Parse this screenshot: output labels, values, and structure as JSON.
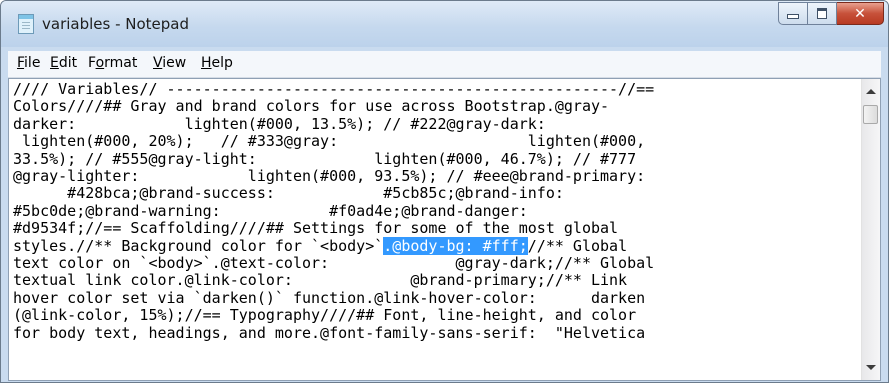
{
  "window": {
    "title": "variables - Notepad",
    "icon": "notepad-icon",
    "controls": {
      "minimize": "minimize-icon",
      "maximize": "maximize-icon",
      "close": "close-icon",
      "close_glyph": "✕"
    },
    "close_color": "#c7513a"
  },
  "menu": {
    "items": [
      {
        "first": "F",
        "rest": "ile"
      },
      {
        "first": "E",
        "rest": "dit"
      },
      {
        "first": "F",
        "rest": "ormat",
        "underline_index": 1
      },
      {
        "first": "V",
        "rest": "iew"
      },
      {
        "first": "H",
        "rest": "elp"
      }
    ]
  },
  "editor": {
    "lines": [
      "//// Variables// --------------------------------------------------//==",
      "Colors////## Gray and brand colors for use across Bootstrap.@gray-",
      "darker:            lighten(#000, 13.5%); // #222@gray-dark:",
      " lighten(#000, 20%);   // #333@gray:                     lighten(#000,",
      "33.5%); // #555@gray-light:             lighten(#000, 46.7%); // #777",
      "@gray-lighter:            lighten(#000, 93.5%); // #eee@brand-primary:",
      "      #428bca;@brand-success:            #5cb85c;@brand-info:",
      "#5bc0de;@brand-warning:            #f0ad4e;@brand-danger:",
      "#d9534f;//== Scaffolding////## Settings for some of the most global",
      "text color on `<body>`.@text-color:              @gray-dark;//** Global",
      "textual link color.@link-color:             @brand-primary;//** Link",
      "hover color set via `darken()` function.@link-hover-color:      darken",
      "(@link-color, 15%);//== Typography////## Font, line-height, and color",
      "for body text, headings, and more.@font-family-sans-serif:  \"Helvetica"
    ],
    "styles_line": {
      "before": "styles.//** Background color for `<body>`",
      "selected": ".@body-bg: #fff;",
      "after": "//** Global"
    },
    "selection_color": "#3399ff"
  },
  "scrollbar": {
    "up": "scroll-up-arrow-icon",
    "down": "scroll-down-arrow-icon"
  }
}
